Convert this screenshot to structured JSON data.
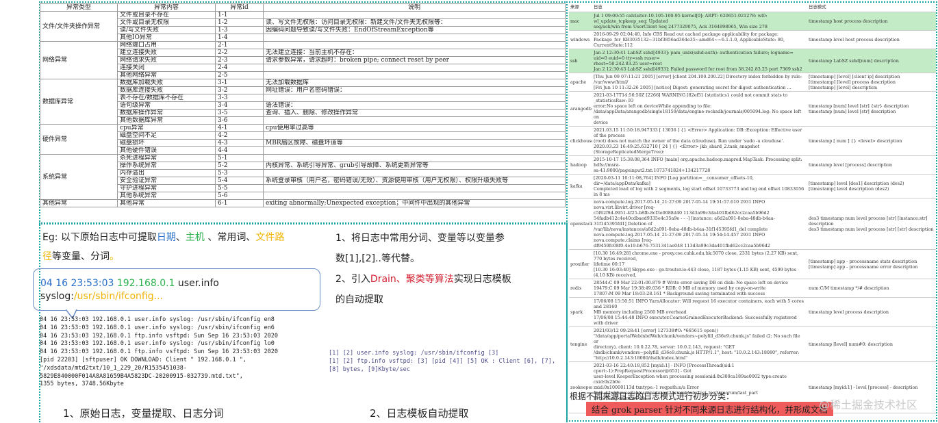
{
  "error_table": {
    "headers": [
      "异常类型",
      "异常内容",
      "异常id",
      "说明"
    ],
    "groups": [
      {
        "category": "文件/文件夹操作异常",
        "rows": [
          {
            "content": "文件或目录不存在",
            "id": "1-1",
            "desc": ""
          },
          {
            "content": "文件或目录无权限",
            "id": "1-2",
            "desc": "读、写文件无权限：访问目录无权限：新建文件/文件夹无权限等："
          },
          {
            "content": "读/写文件失败",
            "id": "1-3",
            "desc": "因编码问题导致读/写文件失败：EndOfStreamException等"
          },
          {
            "content": "其他IO异常",
            "id": "1-4",
            "desc": ""
          }
        ]
      },
      {
        "category": "网络异常",
        "rows": [
          {
            "content": "网络端口占用",
            "id": "2-1",
            "desc": ""
          },
          {
            "content": "建立连接失败",
            "id": "2-2",
            "desc": "无法建立连接：当前主机不存在："
          },
          {
            "content": "网络请求失败",
            "id": "2-3",
            "desc": "请求参数异常，请求超时：broken pipe; connect reset by peer"
          },
          {
            "content": "连接关闭",
            "id": "2-4",
            "desc": ""
          },
          {
            "content": "其他网络异常",
            "id": "2-5",
            "desc": ""
          }
        ]
      },
      {
        "category": "数据库异常",
        "rows": [
          {
            "content": "数据库加载失败",
            "id": "3-1",
            "desc": "无法加载数据库"
          },
          {
            "content": "数据库连接失败",
            "id": "3-2",
            "desc": "网址错误：用户名密码错误："
          },
          {
            "content": "表不存在/数据库不存在",
            "id": "3-3",
            "desc": ""
          },
          {
            "content": "语句级异常",
            "id": "3-4",
            "desc": "语法错误："
          },
          {
            "content": "数据库操作异常",
            "id": "3-5",
            "desc": "查询、插入、删除、修改操作异常"
          },
          {
            "content": "其他数据库异常",
            "id": "3-6",
            "desc": ""
          }
        ]
      },
      {
        "category": "硬件异常",
        "rows": [
          {
            "content": "cpu异常",
            "id": "4-1",
            "desc": "cpu使用率过高等"
          },
          {
            "content": "磁盘空间不足",
            "id": "4-2",
            "desc": ""
          },
          {
            "content": "磁盘损坏",
            "id": "4-3",
            "desc": "MBR扇区故障、磁盘坏道等"
          },
          {
            "content": "其他硬件错误",
            "id": "4-4",
            "desc": ""
          }
        ]
      },
      {
        "category": "系统异常",
        "rows": [
          {
            "content": "杀死进程异常",
            "id": "5-1",
            "desc": ""
          },
          {
            "content": "操作系统异常",
            "id": "5-2",
            "desc": "内核异常、系统引导异常、grub引导故障、系统更新异常等"
          },
          {
            "content": "内存溢出",
            "id": "5-3",
            "desc": ""
          },
          {
            "content": "安全验证异常",
            "id": "5-4",
            "desc": "系统登录审核（用户名，密码错误/无效）、资源使用审核（用户无权限）、权限升级失败等"
          },
          {
            "content": "守护进程异常",
            "id": "5-5",
            "desc": ""
          },
          {
            "content": "其他系统异常",
            "id": "5-6",
            "desc": ""
          }
        ]
      },
      {
        "category": "其他异常",
        "rows": [
          {
            "content": "其他异常",
            "id": "6-1",
            "desc": "exiting abnormally;Unexpected exception；中间件中出现的其他异常"
          }
        ]
      }
    ]
  },
  "example": {
    "l1_a": "Eg: 以下原始日志中可提取",
    "l1_date": "日期",
    "l1_sep1": "、",
    "l1_host": "主机",
    "l1_sep2": " 、常用词、",
    "l1_path": "文件路",
    "l2_path": "径",
    "l2_rest": "等变量、分词",
    "l2_dot": "。",
    "bubble_date": "04 16 23:53:03",
    "bubble_ip": "192.168.0.1",
    "bubble_rest": " user.info",
    "bubble_l2a": "syslog:",
    "bubble_l2b": "/usr/sbin/ifconfig...",
    "raw_log": "04 16 23:53:03 192.168.0.1 user.info syslog: /usr/sbin/ifconfig en8\n04 16 23:53:03 192.168.0.1 user.info syslog: /usr/sbin/ifconfig en6\n04 16 23:53:03 192.168.0.1 ftp.info vsftpd: Sun Sep 16 23:53:03 2020\n04 16 23:53:03 192.168.0.1 user.info syslog: /usr/sbin/ifconfig lo0\n04 16 23:53:03 192.168.0.1 ftp.info vsftpd: Sun Sep 16 23:53:03 2020\n[pid 22203] [sftpuser] OK DOWNLOAD: Client \" 192.168.0.1 \",\n\"/xdsdata/mtd2txt/10_1_229_20/R1535451038-\n5829E840000F014A8A81659B4A5823DC-20200915-032739.mtd.txt\",\n1355 bytes, 3748.56Kbyte",
    "caption1": "1、原始日志，变量提取、日志分词"
  },
  "steps": {
    "s1_a": "1、将日志中常用分词、变量等以变量参",
    "s1_b": "数[1],[2]..等代替。",
    "s2_a": "2、引入",
    "s2_red": "Drain、聚类等算法",
    "s2_b": "实现日志模板",
    "s2_c": "的自动提取",
    "template_log": "[1] [2] user.info syslog: /usr/sbin/ifconfig [3]\n[1] [2] ftp.info vsftpd: [3] [pid [4]] [5] OK : Client [6], [7],\n[8] bytes, [9]Kbyte/sec",
    "caption2": "2、日志模板自动提取"
  },
  "log_table": {
    "headers": [
      "来源",
      "日志",
      "日志模式"
    ],
    "rows": [
      {
        "src": "mac",
        "log": "Jul 1 09:00:55 calvisitor-10-105-160-95 kernel[0]: ARPT: 620651.021278: wl0: wl_update_tcpkeep_seq: Updated\nseq/ack/win from UserClient Seq 2477329075, Ack 3164998065, Win size 278",
        "pat": "timestamp host process description",
        "hl": true
      },
      {
        "src": "windows",
        "log": "2016-09-29 02:04:40, Info CBS Read out cached package applicability for package:\nPackage_for_KB3035132~31bf3856ad364e35~amd64~~6.1.1.0, ApplicableState: 80, CurrentState:112",
        "pat": "timestamp level host process description",
        "hl": false
      },
      {
        "src": "ssh",
        "log": "Jan 2 12:30:41 LabSZ sshd[4933]: pam_unix(sshd:auth): authentication failure; logname= uid=0 euid=0 tty=ssh ruser=\nrhost=58.242.83.25 user=root\nJan 2 12:30:43 LabSZ sshd[4933]: Failed password for root from 58.242.83.25 port 7369 ssh2",
        "pat": "timestamp LabSZ sshd[num] description",
        "hl": true
      },
      {
        "src": "apache",
        "log": "[Thu Jun 09 07:11:21 2005] [error] [client 204.100.200.22] Directory index forbidden by rule:\n/var/www/html/\n[Fri Jun 10 11:32:26 2005] [notice] Digest: generating secret for digest authentication ...",
        "pat": "[timestamp] [level] [client ip] description\n[timestamp] [level] process description\n[timestamp] [level] description",
        "hl": false
      },
      {
        "src": "arangodb",
        "log": "2021-03-17T14:56:50Z [2266] WARNING [82ef5] {statistics} could not commit stats to _statisticsRaw: IO\nerror:No space left on deviceWhile appending to file:\n/data/appData/arangodb/single18159/data/engine-rocksdb/journals/005094.log: No space left on\ndevice",
        "pat": "timestamp [num] level [str] {str} description\ntimestamp [num] level [str] description",
        "hl": false
      },
      {
        "src": "clickhouse",
        "log": "2021.03.15 11:50:18.947333 [ 13036 ] {} <Error> Application: DB::Exception: Effective user of the process\n(root) does not match the owner of the data (clouduse). Run under 'sudo -u clouduse'.\n2020.03.23 16:49:25.632710 [ 24 ] {} <Error> jkb_shard_2.task_snapshot (StorageReplicatedMergeTree):",
        "pat": "timestamp [ num ] {} <level> description",
        "hl": false
      },
      {
        "src": "hadoop",
        "log": "2015-10-17 15:38:08,364 INFO [main] org.apache.hadoop.mapred.MapTask: Processing split: hdfs://msra-\nsa-41:9000/pageinput2.txt:1073741824+134217728",
        "pat": "timestamp level [process] description",
        "hl": false
      },
      {
        "src": "kafka",
        "log": "[2020-03-11 10:11:08,764] INFO [Log partition=__consumer_offsets-10, dir=/data/appData/kafka]\nCompleted load of log with 2 segments, log start offset 10733773 and log end offset 10833056 in 8 ms",
        "pat": "[timestamp] level [des1] description (des2)\n[timestamp] level description (des2)",
        "hl": false
      },
      {
        "src": "openstack",
        "log": "nova-compute.log.2017-05-14_21:27:09 2017-05-14 19:51:57.610 2931 INFO nova.virt.libvirt.driver [req-\nc5f62f9d-0951-4f25-b8fb-8cf3e0088d40 113d3a99c3da401fbd62cc2caa5b96d2\n54fadb412c4e40cdbaed9335e4c35a9e - - -] [instance: a6d2a091-0eba-48db-b4aa-31f145395fd1] Deletion of\n/var/lib/nova/instances/a6d2a091-0eba-48db-b4aa-31f145395fd1_del complete\nnova-compute.log.2017-05-14_21:27:09 2017-05-14 19:54:14.457 2931 INFO nova.compute.claims [req-\ndf9459fc08f0-4e19-b676-7531341ae048 113d3a99c3da401fbd62cc2caa5b96d2",
        "pat": "des3 timestamp num level process [str] [instance:str] description\ndes3 timestamp num level process [str] [str] description",
        "hl": false
      },
      {
        "src": "proxifier",
        "log": "[10.30 16:49:28] chrome.exe - proxy.cse.cuhk.edu.hk:5070 close, 2331 bytes (2.27 KB) sent, 770 bytes received,\nlifetime 00:17\n[10.30 16:03:40] Skype.exe - go.trouter.io:443 close, 1187 bytes (1.15 KB) sent, 4599 bytes (4.10 KB) received,",
        "pat": "[timestamp] app - processname stats description\n[timestamp] app - processname error description",
        "hl": false
      },
      {
        "src": "redis",
        "log": "28544:C 09 Mar 22:01:00.879 # Write error saving DB on disk: No space left on device\n19479:C 09 Mar 19:38:49.036 * RDB: 0 MB of memory used by copy-on-write\n17807:M 09 Mar 18:03:28.161 * Background saving terminated with success",
        "pat": "num:C/M timestamp */# description",
        "hl": false
      },
      {
        "src": "spark",
        "log": "17/06/08 15:50:51 INFO YarnAllocator: Will request 16 executor containers, each with 5 cores and 28160\nMB memory including 2560 MB overhead\n17/06/08 15:44:48 INFO executor.CoarseGrainedExecutorBackend: Successfully registered with driver",
        "pat": "timestamp level process description",
        "hl": false
      },
      {
        "src": "tengine",
        "log": "2021/03/12 09:28:41 [error] 127338#0: *665615 open()\n\"/data/app/portalWeb/nbdWeb/chunk/vendors~polyfill_d36e9.chunk.js\" failed (2: No such file or\ndirectory), client: 10.0.22.78, server: 10.0.2.143, request: \"GET\n/dsdb/chunk/vendors~polyfill_d36e9.chunk.js HTTP/1.1\", host: \"10.0.2.143:18080\", referrer:\n\"http://10.0.2.143:18080/dsdb/index.html\"",
        "pat": "timestamp [level] num#0: description",
        "hl": false
      },
      {
        "src": "zookeeper",
        "log": "2021-03-16 22:40:18,852 [myid:1] - INFO [ProcessThread(sid:1 cport:-1):PrepRequestProcessor@653] - Got\nuser-level KeeperException when processing sessionid:0x300ca189ae0002 type:create cxid:0x2b0e\nzxid:0x10000113d txntype:-1 reqpath:n/a Error\nPath:/clickhouse/tables/2/autotest3/lcmmtAutoTest_log3/quorum/last_part Error:KeeperErrorCode =\nNodeExists for /clickhouse/tables/2/autotest3/lcmmtAutoTest_log3/quorum/last_part\n2020-03-22 00:00:43,230 [myid:1] - INFO",
        "pat": "timestamp [myid:1] - level [process] - description",
        "hl": false
      }
    ]
  },
  "footer": {
    "line1": "根据不同来源日志的日志模式进行初步分类：",
    "line2": "结合 grok parser 针对不同来源日志进行结构化，并形成文档"
  },
  "watermark": "@稀土掘金技术社区"
}
